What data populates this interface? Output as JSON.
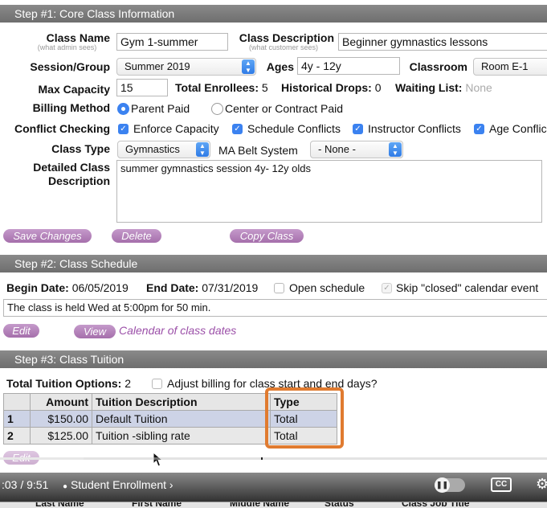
{
  "step1": {
    "title": "Step #1: Core Class Information",
    "class_name": {
      "label": "Class Name",
      "sub": "(what admin sees)",
      "value": "Gym 1-summer"
    },
    "class_description": {
      "label": "Class Description",
      "sub": "(what customer sees)",
      "value": "Beginner gymnastics lessons"
    },
    "session_group": {
      "label": "Session/Group",
      "value": "Summer 2019"
    },
    "ages": {
      "label": "Ages",
      "value": "4y - 12y"
    },
    "classroom": {
      "label": "Classroom",
      "value": "Room E-1"
    },
    "max_capacity": {
      "label": "Max Capacity",
      "value": "15"
    },
    "total_enrollees": {
      "label": "Total Enrollees:",
      "value": "5"
    },
    "historical_drops": {
      "label": "Historical Drops:",
      "value": "0"
    },
    "waiting_list": {
      "label": "Waiting List:",
      "value": "None"
    },
    "billing_method": {
      "label": "Billing Method",
      "option_parent": "Parent Paid",
      "option_center": "Center or Contract Paid"
    },
    "conflict_checking": {
      "label": "Conflict Checking",
      "enforce_capacity": "Enforce Capacity",
      "schedule_conflicts": "Schedule Conflicts",
      "instructor_conflicts": "Instructor Conflicts",
      "age_conflicts": "Age Conflic"
    },
    "class_type": {
      "label": "Class Type",
      "value": "Gymnastics"
    },
    "ma_belt": {
      "label": "MA Belt System",
      "value": "- None -"
    },
    "detailed_description": {
      "label_line1": "Detailed Class",
      "label_line2": "Description",
      "value": "summer gymnastics session 4y- 12y olds"
    },
    "buttons": {
      "save": "Save Changes",
      "delete": "Delete",
      "copy": "Copy Class"
    }
  },
  "step2": {
    "title": "Step #2: Class Schedule",
    "begin_date": {
      "label": "Begin Date:",
      "value": "06/05/2019"
    },
    "end_date": {
      "label": "End Date:",
      "value": "07/31/2019"
    },
    "open_schedule": "Open schedule",
    "skip_closed": "Skip \"closed\" calendar event",
    "schedule_text": "The class is held Wed at 5:00pm for 50 min.",
    "buttons": {
      "edit": "Edit",
      "view": "View"
    },
    "calendar_link": "Calendar of class dates"
  },
  "step3": {
    "title": "Step #3: Class Tuition",
    "total_options": {
      "label": "Total Tuition Options:",
      "value": "2"
    },
    "adjust_billing": "Adjust billing for class start and end days?",
    "table": {
      "headers": {
        "amount": "Amount",
        "description": "Tuition Description",
        "type": "Type"
      },
      "rows": [
        {
          "num": "1",
          "amount": "$150.00",
          "description": "Default Tuition",
          "type": "Total"
        },
        {
          "num": "2",
          "amount": "$125.00",
          "description": "Tuition -sibling rate",
          "type": "Total"
        }
      ]
    },
    "edit": "Edit"
  },
  "video": {
    "time": ":03 / 9:51",
    "chapter": "Student Enrollment",
    "cc": "CC"
  },
  "bottom_headers": [
    "Last Name",
    "First Name",
    "Middle Name",
    "Status",
    "Class Job Title"
  ],
  "colors": {
    "step_bar": "#777777",
    "pill": "#b07fb6",
    "checkbox": "#3b82f0",
    "highlight_box": "#e07b30"
  }
}
